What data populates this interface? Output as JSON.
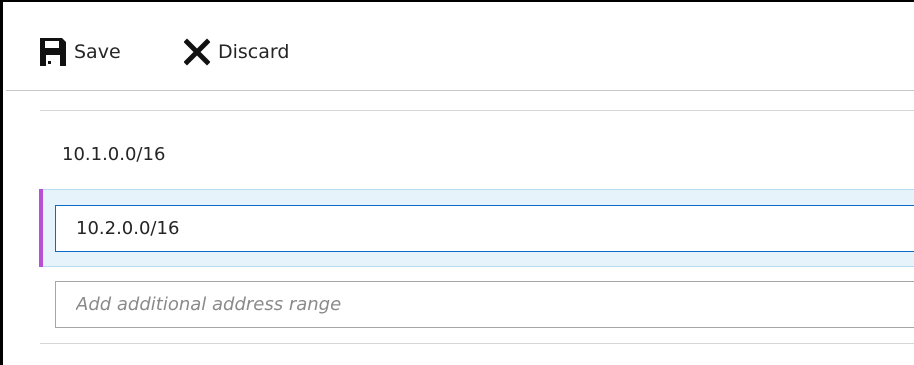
{
  "toolbar": {
    "save_label": "Save",
    "save_icon": "save-icon",
    "discard_label": "Discard",
    "discard_icon": "close-icon"
  },
  "address_ranges": {
    "items": [
      "10.1.0.0/16",
      "10.2.0.0/16"
    ],
    "add_placeholder": "Add additional address range",
    "add_value": ""
  },
  "colors": {
    "selected_accent": "#b84fd6",
    "selected_background": "#e6f3fa",
    "focus_border": "#0a6bc8"
  }
}
